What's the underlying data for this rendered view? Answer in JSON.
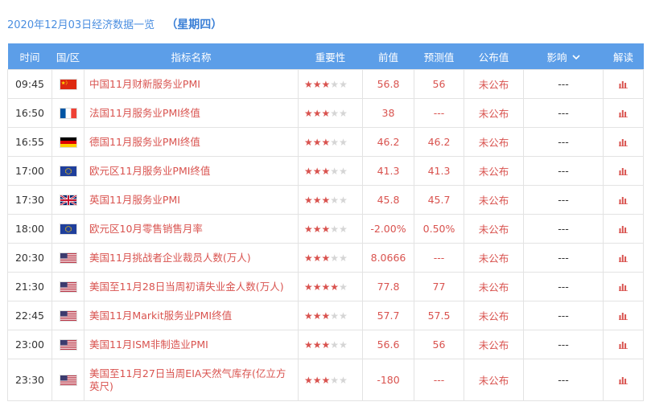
{
  "header": {
    "title": "2020年12月03日经济数据一览",
    "weekday": "（星期四）"
  },
  "columns": {
    "time": "时间",
    "region": "国/区",
    "indicator": "指标名称",
    "importance": "重要性",
    "previous": "前值",
    "forecast": "预测值",
    "actual": "公布值",
    "influence": "影响",
    "analysis": "解读"
  },
  "colors": {
    "header_bg": "#5c9ee8",
    "accent_red": "#d9534f",
    "title_blue": "#4a8ee0",
    "star_off": "#d5d5d5"
  },
  "rows": [
    {
      "time": "09:45",
      "flag": "cn-flag-icon",
      "indicator": "中国11月财新服务业PMI",
      "stars": 3,
      "previous": "56.8",
      "forecast": "56",
      "actual": "未公布",
      "influence": "---"
    },
    {
      "time": "16:50",
      "flag": "fr-flag-icon",
      "indicator": "法国11月服务业PMI终值",
      "stars": 3,
      "previous": "38",
      "forecast": "---",
      "actual": "未公布",
      "influence": "---"
    },
    {
      "time": "16:55",
      "flag": "de-flag-icon",
      "indicator": "德国11月服务业PMI终值",
      "stars": 3,
      "previous": "46.2",
      "forecast": "46.2",
      "actual": "未公布",
      "influence": "---"
    },
    {
      "time": "17:00",
      "flag": "eu-flag-icon",
      "indicator": "欧元区11月服务业PMI终值",
      "stars": 3,
      "previous": "41.3",
      "forecast": "41.3",
      "actual": "未公布",
      "influence": "---"
    },
    {
      "time": "17:30",
      "flag": "uk-flag-icon",
      "indicator": "英国11月服务业PMI",
      "stars": 3,
      "previous": "45.8",
      "forecast": "45.7",
      "actual": "未公布",
      "influence": "---"
    },
    {
      "time": "18:00",
      "flag": "eu-flag-icon",
      "indicator": "欧元区10月零售销售月率",
      "stars": 3,
      "previous": "-2.00%",
      "forecast": "0.50%",
      "actual": "未公布",
      "influence": "---"
    },
    {
      "time": "20:30",
      "flag": "us-flag-icon",
      "indicator": "美国11月挑战者企业裁员人数(万人)",
      "stars": 3,
      "previous": "8.0666",
      "forecast": "---",
      "actual": "未公布",
      "influence": "---"
    },
    {
      "time": "21:30",
      "flag": "us-flag-icon",
      "indicator": "美国至11月28日当周初请失业金人数(万人)",
      "stars": 4,
      "previous": "77.8",
      "forecast": "77",
      "actual": "未公布",
      "influence": "---"
    },
    {
      "time": "22:45",
      "flag": "us-flag-icon",
      "indicator": "美国11月Markit服务业PMI终值",
      "stars": 3,
      "previous": "57.7",
      "forecast": "57.5",
      "actual": "未公布",
      "influence": "---"
    },
    {
      "time": "23:00",
      "flag": "us-flag-icon",
      "indicator": "美国11月ISM非制造业PMI",
      "stars": 3,
      "previous": "56.6",
      "forecast": "56",
      "actual": "未公布",
      "influence": "---"
    },
    {
      "time": "23:30",
      "flag": "us-flag-icon",
      "indicator": "美国至11月27日当周EIA天然气库存(亿立方英尺)",
      "stars": 3,
      "previous": "-180",
      "forecast": "---",
      "actual": "未公布",
      "influence": "---"
    }
  ]
}
